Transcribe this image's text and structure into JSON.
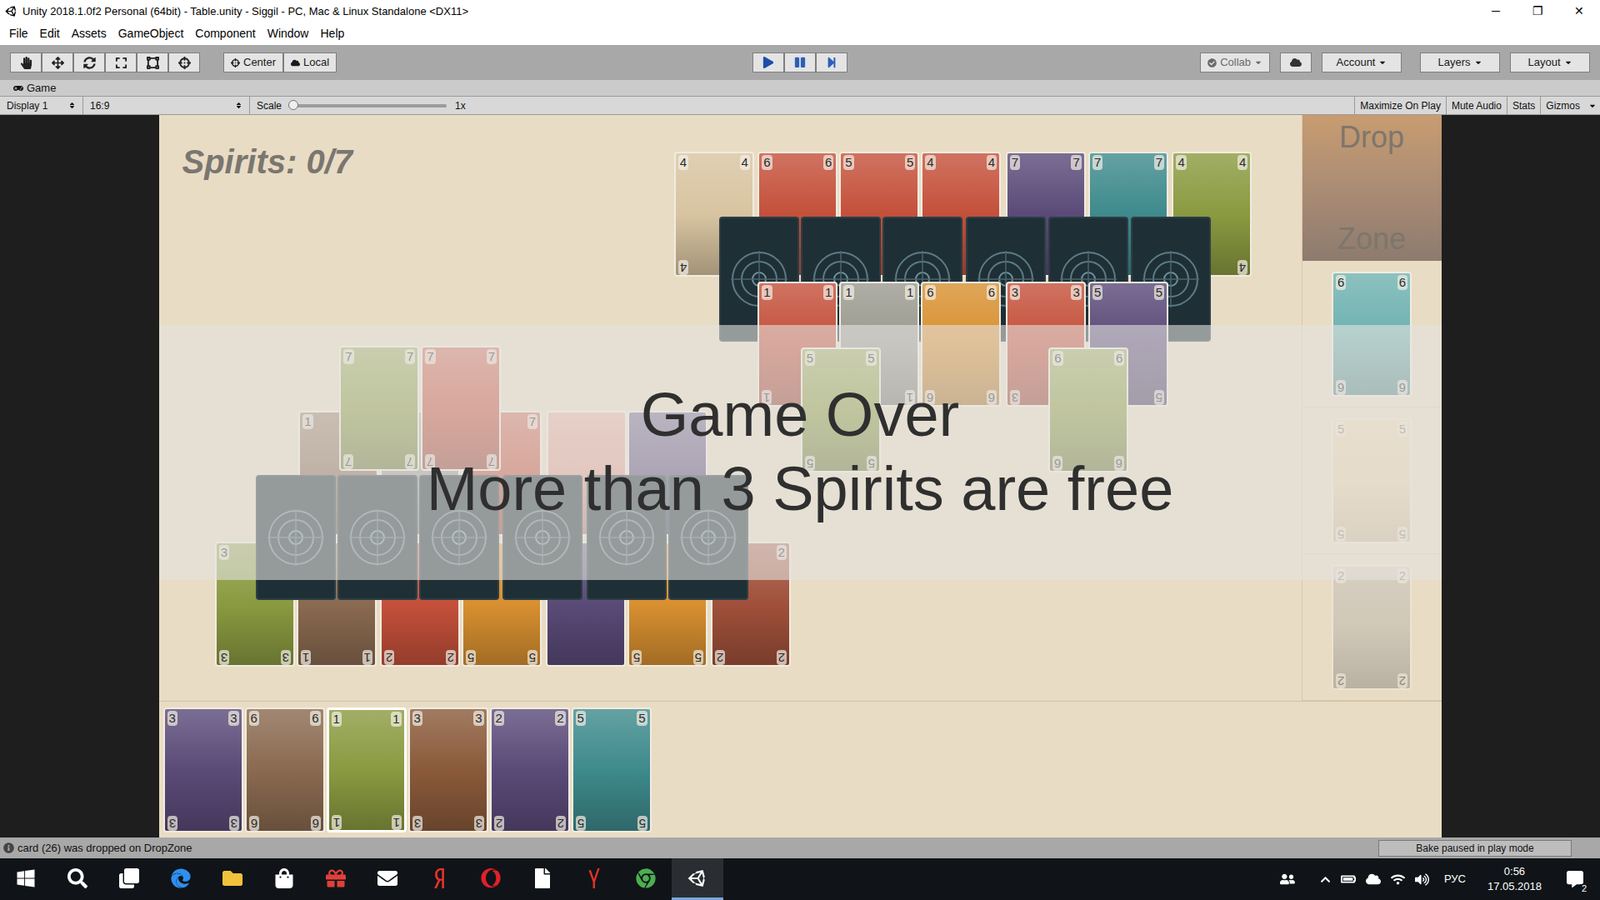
{
  "window": {
    "title": "Unity 2018.1.0f2 Personal (64bit) - Table.unity - Siggil - PC, Mac & Linux Standalone <DX11>",
    "controls": [
      "─",
      "❐",
      "✕"
    ]
  },
  "menu": [
    "File",
    "Edit",
    "Assets",
    "GameObject",
    "Component",
    "Window",
    "Help"
  ],
  "toolbar": {
    "tools": [
      {
        "kind": "hand",
        "selected": false
      },
      {
        "kind": "move",
        "selected": false
      },
      {
        "kind": "rotate",
        "selected": false
      },
      {
        "kind": "scale",
        "selected": false
      },
      {
        "kind": "rect",
        "selected": false
      },
      {
        "kind": "transform",
        "selected": false
      }
    ],
    "pivot": "Center",
    "space": "Local",
    "playback": [
      {
        "kind": "play",
        "active": true
      },
      {
        "kind": "pause",
        "active": false
      },
      {
        "kind": "step",
        "active": false
      }
    ],
    "collab": "Collab",
    "account": "Account",
    "layers": "Layers",
    "layout": "Layout"
  },
  "game_tab": {
    "label": "Game",
    "selected": true
  },
  "game_toolbar": {
    "display": "Display 1",
    "aspect": "16:9",
    "scale_label": "Scale",
    "scale_value": "1x",
    "scale_level": 0,
    "toggles": [
      {
        "label": "Maximize On Play",
        "on": false
      },
      {
        "label": "Mute Audio",
        "on": false
      },
      {
        "label": "Stats",
        "on": false
      },
      {
        "label": "Gizmos",
        "on": false
      }
    ]
  },
  "game": {
    "spirits": "Spirits: 0/7",
    "overlay": {
      "title": "Game Over",
      "message": "More than 3 Spirits are free"
    },
    "table_cards": [
      {
        "value": "4",
        "color": "#d8c4a0",
        "face_up": true
      },
      {
        "value": "6",
        "color": "#c4503a",
        "face_up": true
      },
      {
        "value": "5",
        "color": "#c4503a",
        "face_up": true
      },
      {
        "value": "4",
        "color": "#c4503a",
        "face_up": true
      },
      {
        "value": "7",
        "color": "#5a4a78",
        "face_up": true
      },
      {
        "value": "7",
        "color": "#3e8a8c",
        "face_up": true
      },
      {
        "value": "4",
        "color": "#8a9a40",
        "face_up": true
      },
      {
        "value": "",
        "color": "#1f2f36",
        "face_up": false
      },
      {
        "value": "",
        "color": "#1f2f36",
        "face_up": false
      },
      {
        "value": "",
        "color": "#1f2f36",
        "face_up": false
      },
      {
        "value": "",
        "color": "#1f2f36",
        "face_up": false
      },
      {
        "value": "",
        "color": "#1f2f36",
        "face_up": false
      },
      {
        "value": "",
        "color": "#1f2f36",
        "face_up": false
      },
      {
        "value": "1",
        "color": "#c4503a",
        "face_up": true
      },
      {
        "value": "1",
        "color": "#9a9a90",
        "face_up": true
      },
      {
        "value": "6",
        "color": "#d89030",
        "face_up": true
      },
      {
        "value": "3",
        "color": "#c4503a",
        "face_up": true
      },
      {
        "value": "5",
        "color": "#5a4a78",
        "face_up": true
      },
      {
        "value": "5",
        "color": "#8a9a40",
        "face_up": true
      },
      {
        "value": "6",
        "color": "#8a9a40",
        "face_up": true
      },
      {
        "value": "3",
        "color": "#8a9a40",
        "face_up": true
      },
      {
        "value": "1",
        "color": "#8a6a50",
        "face_up": true
      },
      {
        "value": "2",
        "color": "#c4503a",
        "face_up": true
      },
      {
        "value": "5",
        "color": "#d89030",
        "face_up": true
      },
      {
        "value": "",
        "color": "#5a4a78",
        "face_up": true
      },
      {
        "value": "5",
        "color": "#d89030",
        "face_up": true
      },
      {
        "value": "2",
        "color": "#a0503a",
        "face_up": true
      },
      {
        "value": "1",
        "color": "#8a6a50",
        "face_up": true
      },
      {
        "value": "",
        "color": "#9a9a90",
        "face_up": true
      },
      {
        "value": "7",
        "color": "#c4503a",
        "face_up": true
      },
      {
        "value": "",
        "color": "#e0a090",
        "face_up": true
      },
      {
        "value": "",
        "color": "#5a4a78",
        "face_up": true
      },
      {
        "value": "",
        "color": "#1f2f36",
        "face_up": false
      },
      {
        "value": "",
        "color": "#1f2f36",
        "face_up": false
      },
      {
        "value": "",
        "color": "#1f2f36",
        "face_up": false
      },
      {
        "value": "",
        "color": "#1f2f36",
        "face_up": false
      },
      {
        "value": "",
        "color": "#1f2f36",
        "face_up": false
      },
      {
        "value": "",
        "color": "#1f2f36",
        "face_up": false
      },
      {
        "value": "7",
        "color": "#8a9a40",
        "face_up": true
      },
      {
        "value": "7",
        "color": "#c4503a",
        "face_up": true
      }
    ],
    "drop_zone": {
      "title_top": "Drop",
      "title_bottom": "Zone",
      "cards": [
        {
          "value": "6",
          "color": "#6fb2b0",
          "face_up": true,
          "dimmed": false
        },
        {
          "value": "5",
          "color": "#e8c890",
          "face_up": true,
          "dimmed": true
        },
        {
          "value": "2",
          "color": "#b8b4ac",
          "face_up": true,
          "dimmed": true
        }
      ]
    },
    "hand": [
      {
        "value": "3",
        "color": "#5a4a78",
        "face_up": true,
        "selected": false
      },
      {
        "value": "6",
        "color": "#8a6a50",
        "face_up": true,
        "selected": false
      },
      {
        "value": "1",
        "color": "#8a9a40",
        "face_up": true,
        "selected": true
      },
      {
        "value": "3",
        "color": "#8a5a3a",
        "face_up": true,
        "selected": false
      },
      {
        "value": "2",
        "color": "#5a4a78",
        "face_up": true,
        "selected": false
      },
      {
        "value": "5",
        "color": "#3e8a8c",
        "face_up": true,
        "selected": false
      }
    ]
  },
  "status_bar": {
    "message": "card (26) was dropped on DropZone",
    "bake": "Bake paused in play mode"
  },
  "taskbar": {
    "apps": [
      {
        "kind": "start",
        "active": false
      },
      {
        "kind": "search",
        "active": false
      },
      {
        "kind": "taskview",
        "active": false
      },
      {
        "kind": "edge",
        "active": false
      },
      {
        "kind": "explorer",
        "active": false
      },
      {
        "kind": "store",
        "active": false
      },
      {
        "kind": "gift",
        "active": false
      },
      {
        "kind": "mail",
        "active": false
      },
      {
        "kind": "yandex",
        "active": false
      },
      {
        "kind": "opera",
        "active": false
      },
      {
        "kind": "file",
        "active": false
      },
      {
        "kind": "yabrowser",
        "active": false
      },
      {
        "kind": "chrome",
        "active": false
      },
      {
        "kind": "unity",
        "active": true
      }
    ],
    "language": "РУС",
    "time": "0:56",
    "date": "17.05.2018",
    "notifications": "2"
  }
}
